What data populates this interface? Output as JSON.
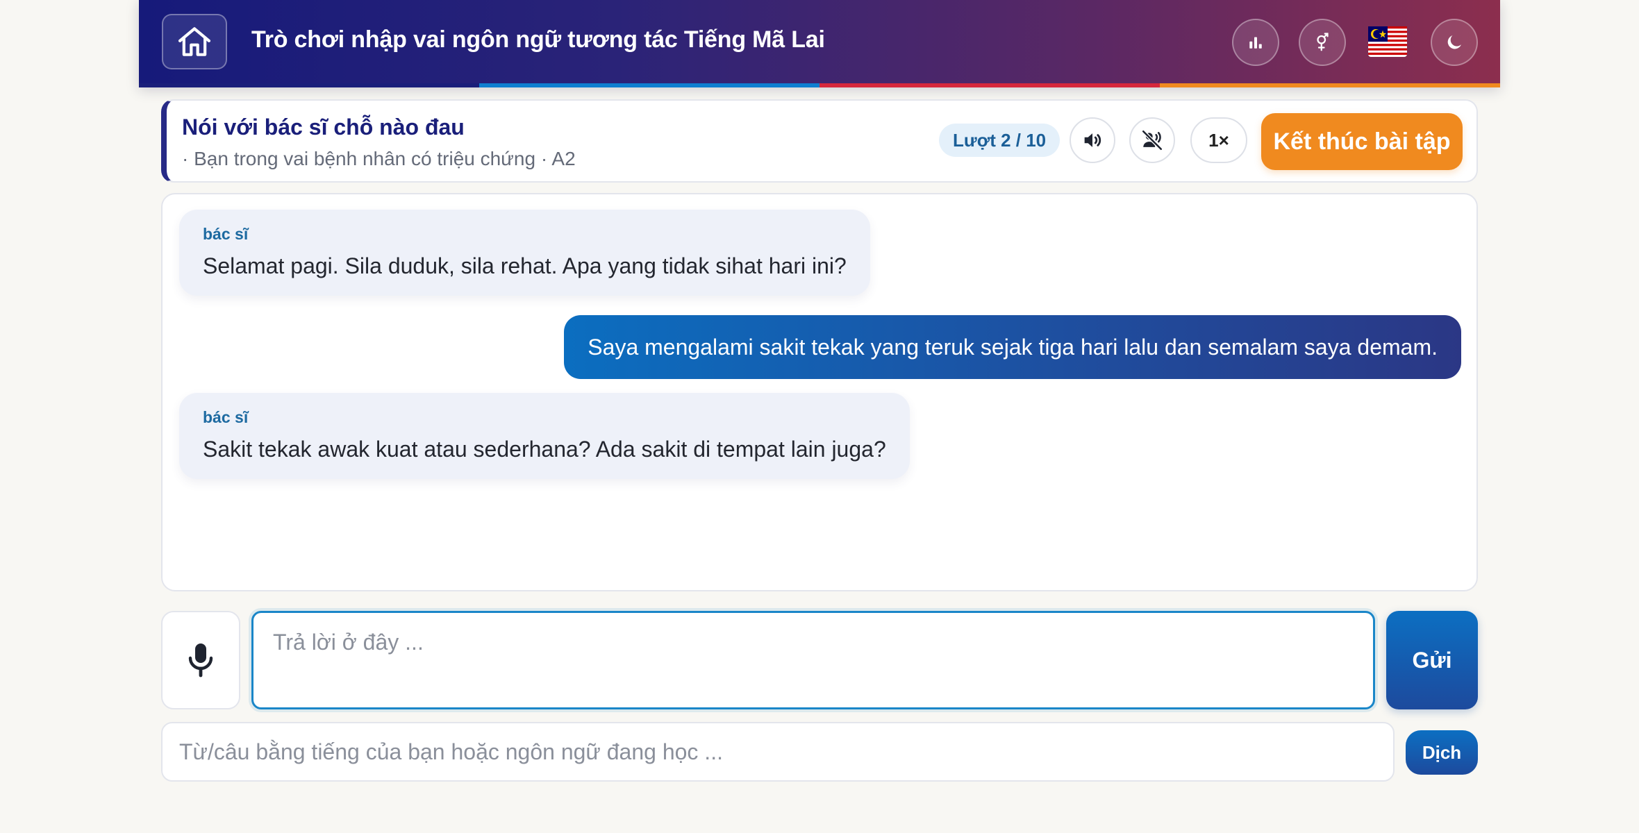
{
  "header": {
    "title": "Trò chơi nhập vai ngôn ngữ tương tác Tiếng Mã Lai",
    "icons": [
      "home-icon",
      "stats-icon",
      "gender-icon",
      "malaysia-flag-icon",
      "dark-mode-icon"
    ],
    "stripe_colors": [
      "#1a1f7a",
      "#0e7fd0",
      "#d6283c",
      "#f08a1f"
    ]
  },
  "scenario": {
    "title": "Nói với bác sĩ chỗ nào đau",
    "subtitle": "· Bạn trong vai bệnh nhân có triệu chứng · A2",
    "turn": "Lượt 2 / 10",
    "speed": "1×",
    "end_label": "Kết thúc bài tập"
  },
  "chat": {
    "messages": [
      {
        "role": "bot",
        "speaker": "bác sĩ",
        "text": "Selamat pagi. Sila duduk, sila rehat. Apa yang tidak sihat hari ini?"
      },
      {
        "role": "user",
        "text": "Saya mengalami sakit tekak yang teruk sejak tiga hari lalu dan semalam saya demam."
      },
      {
        "role": "bot",
        "speaker": "bác sĩ",
        "text": "Sakit tekak awak kuat atau sederhana? Ada sakit di tempat lain juga?"
      }
    ]
  },
  "composer": {
    "reply_placeholder": "Trả lời ở đây ...",
    "send_label": "Gửi",
    "translate_placeholder": "Từ/câu bằng tiếng của bạn hoặc ngôn ngữ đang học ...",
    "translate_label": "Dịch"
  },
  "colors": {
    "accent_orange": "#f08a1f",
    "brand_navy": "#1a1f7a",
    "accent_blue": "#0c6fc2"
  }
}
